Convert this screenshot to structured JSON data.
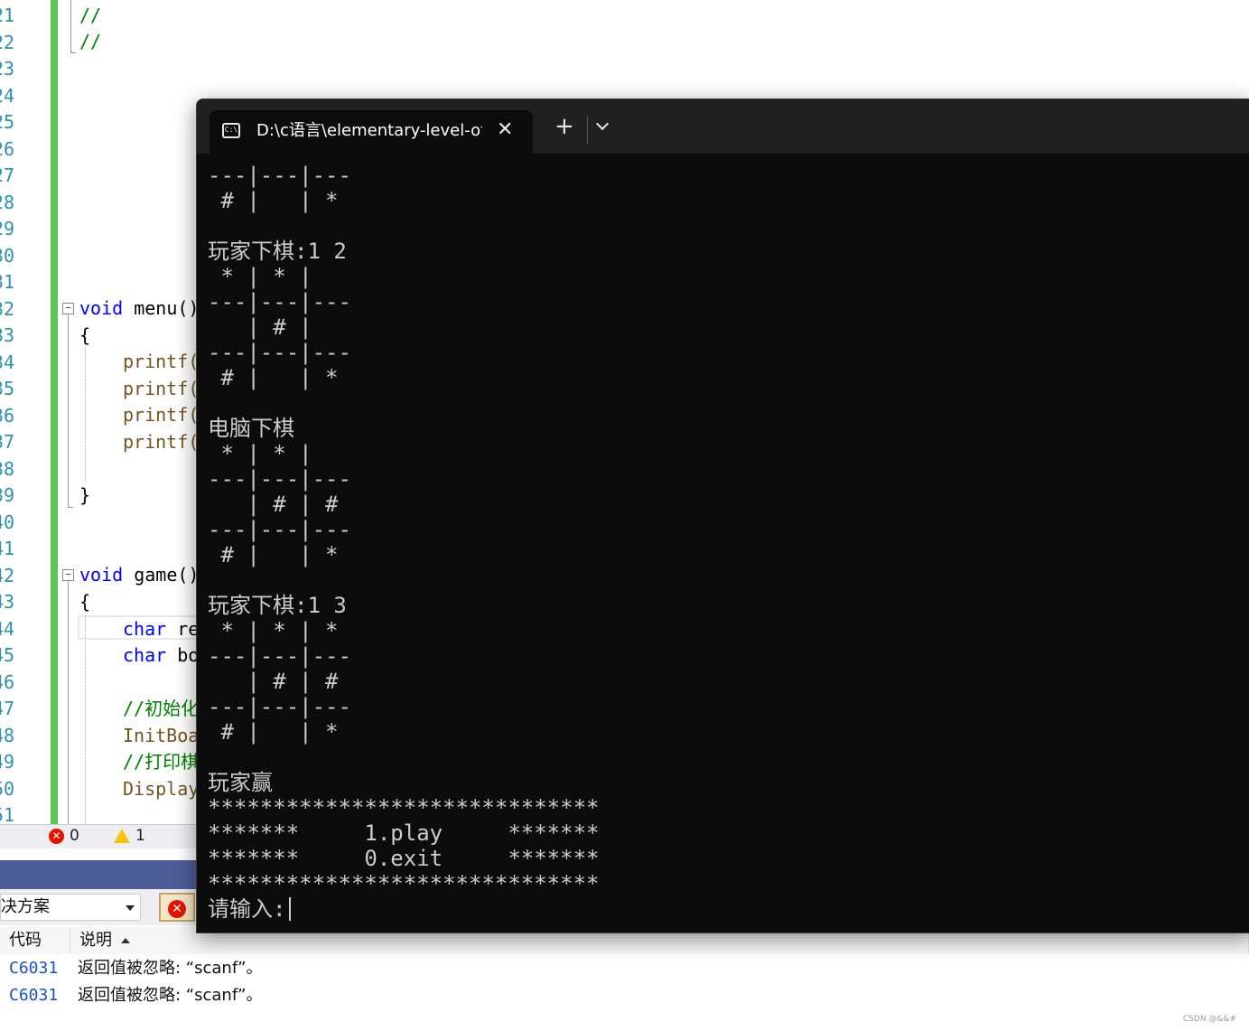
{
  "editor": {
    "line_numbers": [
      "21",
      "22",
      "23",
      "24",
      "25",
      "26",
      "27",
      "28",
      "29",
      "30",
      "31",
      "32",
      "33",
      "34",
      "35",
      "36",
      "37",
      "38",
      "39",
      "40",
      "41",
      "42",
      "43",
      "44",
      "45",
      "46",
      "47",
      "48",
      "49",
      "50",
      "51"
    ],
    "comment_a": "//",
    "comment_b": "//",
    "menu_kw": "void",
    "menu_name": " menu()",
    "brace_open_1": "{",
    "printf_1": "printf(",
    "printf_2": "printf(",
    "printf_3": "printf(",
    "printf_4": "printf(",
    "brace_close_1": "}",
    "game_kw": "void",
    "game_name": " game()",
    "brace_open_2": "{",
    "char_kw_1": "char",
    "char_rest_1": " re",
    "char_kw_2": "char",
    "char_rest_2": " bo",
    "comment_init": "//初始化",
    "initboard": "InitBoa",
    "comment_print": "//打印棋",
    "display": "Display"
  },
  "status": {
    "errors": "0",
    "warnings": "1"
  },
  "error_list": {
    "scope": "决方案",
    "columns": {
      "code": "代码",
      "description": "说明"
    },
    "rows": [
      {
        "code": "C6031",
        "description": "返回值被忽略: “scanf”。"
      },
      {
        "code": "C6031",
        "description": "返回值被忽略: “scanf”。"
      }
    ]
  },
  "terminal": {
    "tab_title": "D:\\c语言\\elementary-level-of-",
    "tab_icon_text": "C:\\",
    "close_symbol": "✕",
    "new_tab_symbol": "+",
    "lines": [
      "---|---|---",
      " # |   | * ",
      "",
      "玩家下棋:1 2",
      " * | * |   ",
      "---|---|---",
      "   | # |   ",
      "---|---|---",
      " # |   | * ",
      "",
      "电脑下棋",
      " * | * |   ",
      "---|---|---",
      "   | # | # ",
      "---|---|---",
      " # |   | * ",
      "",
      "玩家下棋:1 3",
      " * | * | * ",
      "---|---|---",
      "   | # | # ",
      "---|---|---",
      " # |   | * ",
      "",
      "玩家赢",
      "******************************",
      "*******     1.play     *******",
      "*******     0.exit     *******",
      "******************************"
    ],
    "prompt": "请输入:"
  },
  "watermark": "CSDN @&&#",
  "colors": {
    "terminal_bg": "#0c0c0c",
    "terminal_fg": "#cccccc",
    "titlebar": "#202020",
    "keyword": "#0000ff",
    "comment": "#008000",
    "line_number": "#2b91af",
    "modified_bar": "#57c653",
    "error_panel_header": "#4c5c96"
  }
}
